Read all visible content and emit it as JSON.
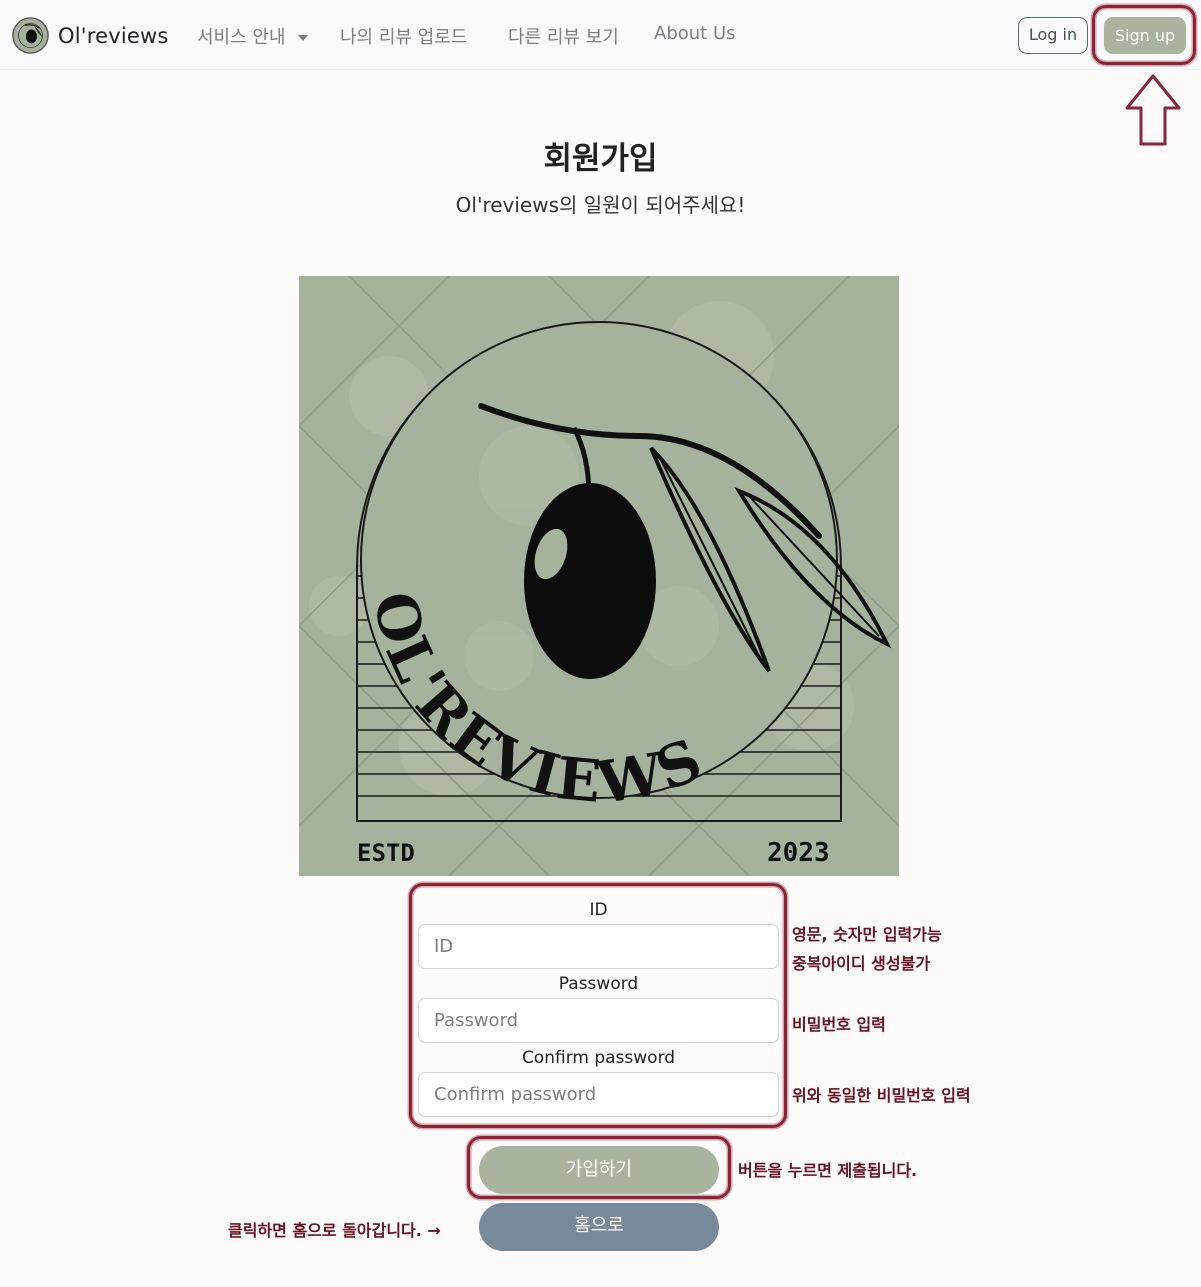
{
  "navbar": {
    "brand": "Ol'reviews",
    "items": [
      {
        "label": "서비스 안내",
        "dropdown": true
      },
      {
        "label": "나의 리뷰 업로드"
      },
      {
        "label": "다른 리뷰 보기"
      },
      {
        "label": "About Us"
      }
    ],
    "login_label": "Log in",
    "signup_label": "Sign up"
  },
  "page": {
    "title": "회원가입",
    "subtitle": "Ol'reviews의 일원이 되어주세요!"
  },
  "logo": {
    "wordmark": "OL'REVIEWS",
    "estd_label": "ESTD",
    "year": "2023",
    "background_color": "#a6b39c"
  },
  "form": {
    "id": {
      "label": "ID",
      "placeholder": "ID"
    },
    "password": {
      "label": "Password",
      "placeholder": "Password"
    },
    "confirm": {
      "label": "Confirm password",
      "placeholder": "Confirm password"
    },
    "submit_label": "가입하기",
    "home_label": "홈으로"
  },
  "annotations": {
    "id_rule_1": "영문, 숫자만 입력가능",
    "id_rule_2": "중복아이디 생성불가",
    "password_note": "비밀번호 입력",
    "confirm_note": "위와 동일한 비밀번호 입력",
    "submit_note": "버튼을 누르면 제출됩니다.",
    "home_note": "클릭하면 홈으로 돌아갑니다. →"
  },
  "colors": {
    "accent_green": "#a9b49e",
    "accent_slate": "#788999",
    "annotation": "#6b1020"
  }
}
